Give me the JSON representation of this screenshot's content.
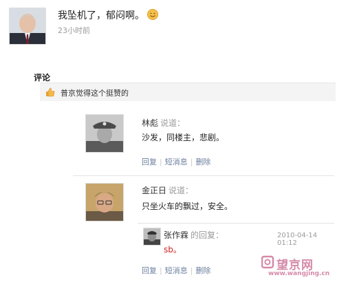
{
  "post": {
    "text": "我坠机了，郁闷啊。",
    "time": "23小时前",
    "emoji": "smile-emoji"
  },
  "comments_section": {
    "title": "评论",
    "like_text": "普京觉得这个挺赞的"
  },
  "comments": [
    {
      "author": "林彪",
      "said": "说道：",
      "text": "沙发，同楼主，悲剧。",
      "actions": [
        "回复",
        "短消息",
        "删除"
      ]
    },
    {
      "author": "金正日",
      "said": "说道：",
      "text": "只坐火车的飘过，安全。",
      "actions": [
        "回复",
        "短消息",
        "删除"
      ],
      "reply": {
        "author": "张作霖",
        "said": "的回复：",
        "text": "sb。",
        "time": "2010-04-14 01:12"
      }
    }
  ],
  "watermark": {
    "brand": "望京网",
    "url": "www.wangjing.cn"
  },
  "colors": {
    "link": "#6b7f9e",
    "muted": "#9a9a9a",
    "reply_text": "#cc2222",
    "watermark": "#d58aa8"
  }
}
